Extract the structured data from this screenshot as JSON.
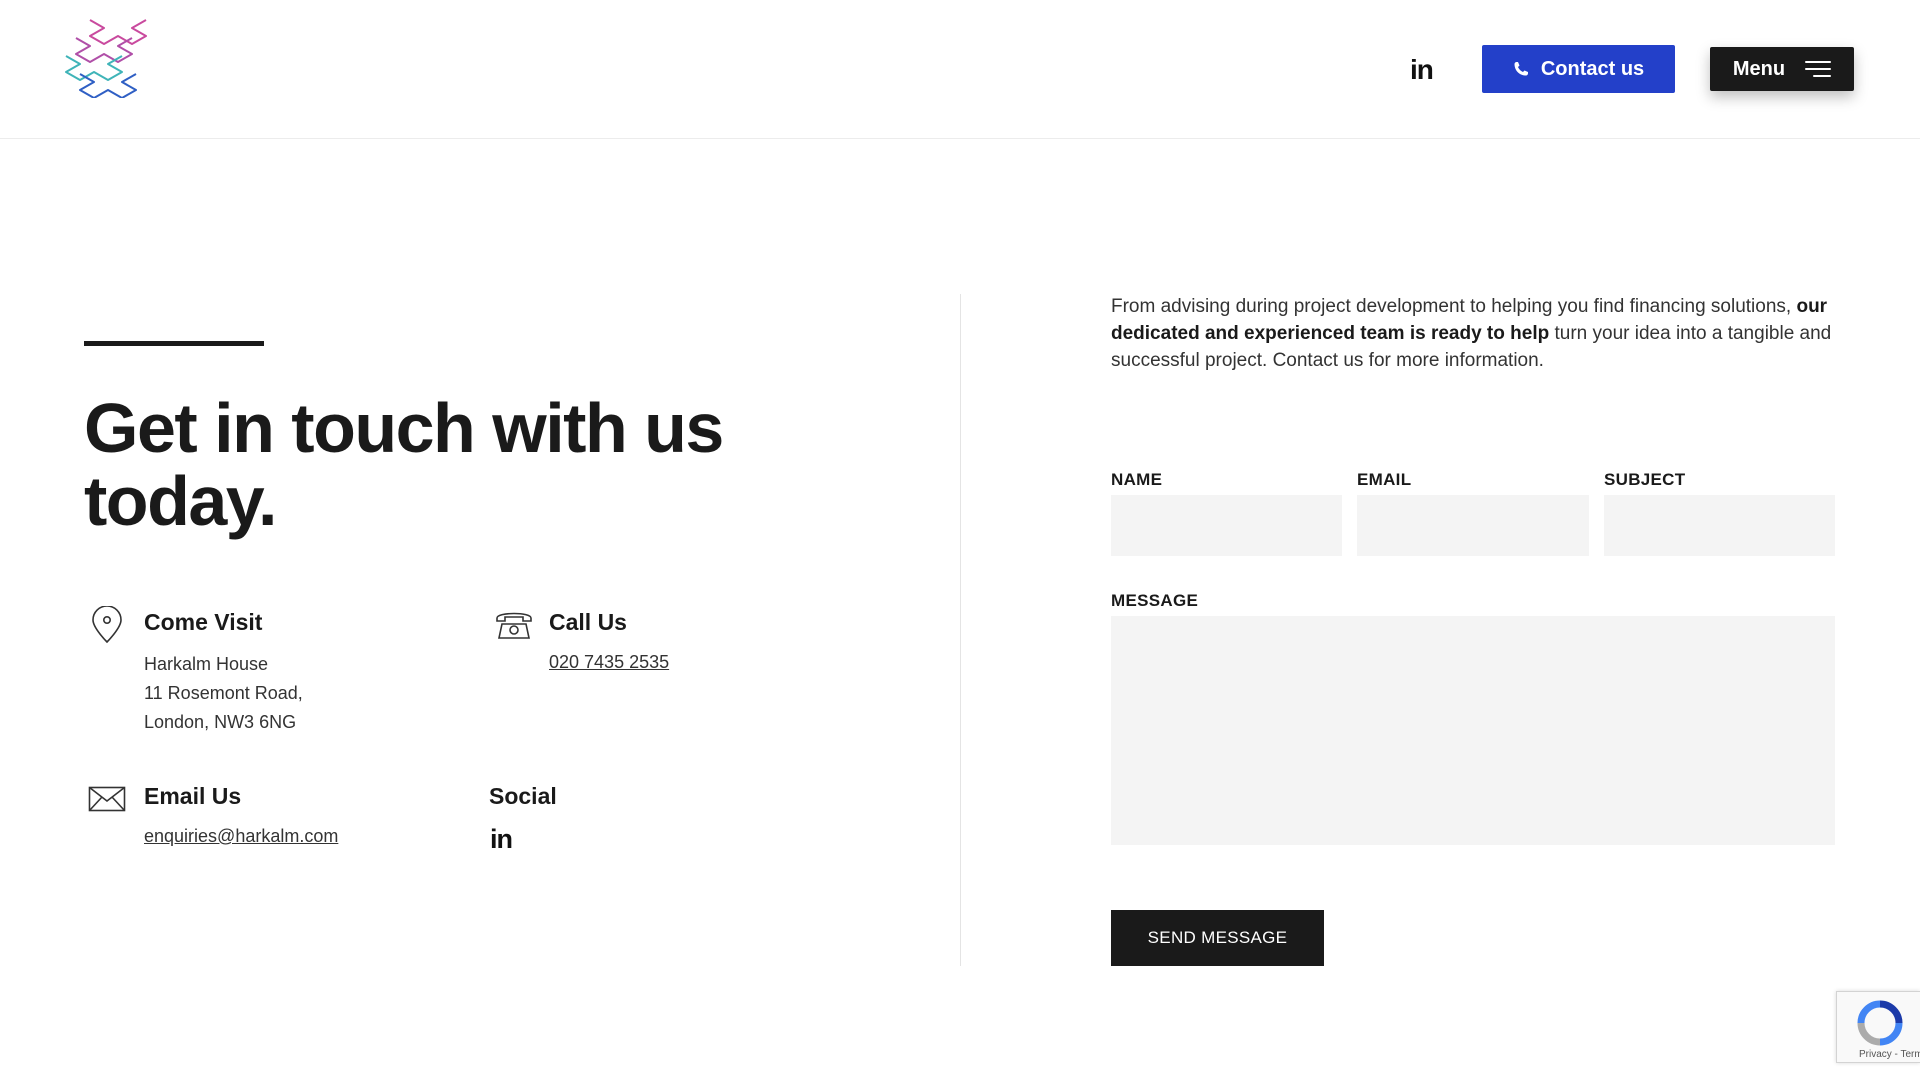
{
  "header": {
    "logo_alt": "Harkalm logo",
    "social_label": "in",
    "contact_label": "Contact us",
    "menu_label": "Menu"
  },
  "hero": {
    "title": "Get in touch with us today."
  },
  "visit": {
    "title": "Come Visit",
    "lines": [
      "Harkalm House",
      "11 Rosemont Road,",
      "London, NW3 6NG"
    ]
  },
  "call": {
    "title": "Call Us",
    "phone": "020 7435 2535"
  },
  "email": {
    "title": "Email Us",
    "address": "enquiries@harkalm.com"
  },
  "social": {
    "title": "Social",
    "linkedin": "in"
  },
  "intro": {
    "text_before": "From advising during project development to helping you find financing solutions, ",
    "text_bold": "our dedicated and experienced team is ready to help",
    "text_after": " turn your idea into a tangible and successful project. Contact us for more information."
  },
  "form": {
    "name_label": "NAME",
    "email_label": "EMAIL",
    "subject_label": "SUBJECT",
    "message_label": "MESSAGE",
    "submit_label": "SEND MESSAGE"
  },
  "recaptcha": {
    "footer": "Privacy - Terms"
  },
  "colors": {
    "accent_blue": "#2340c9",
    "dark": "#1a1a1a",
    "field_bg": "#f4f4f4"
  }
}
